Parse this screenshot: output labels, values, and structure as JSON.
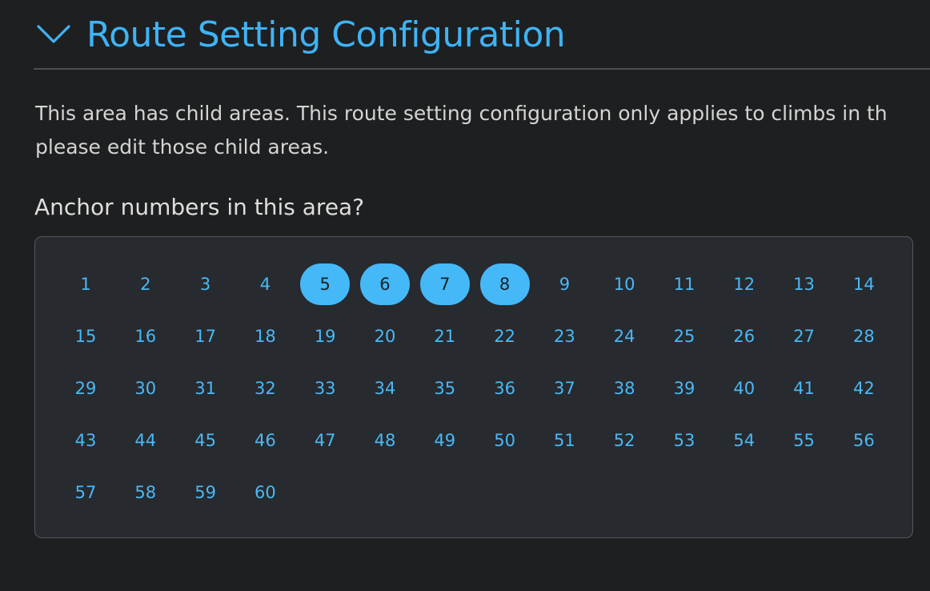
{
  "section": {
    "title": "Route Setting Configuration",
    "toggle_icon": "chevron-down-icon",
    "accent_color": "#3fb3f5"
  },
  "description": {
    "line1": "This area has child areas. This route setting configuration only applies to climbs in th",
    "line2": "please edit those child areas."
  },
  "anchor_question": "Anchor numbers in this area?",
  "anchors": {
    "selected_color": "#45b8f8",
    "items": [
      {
        "label": "1",
        "selected": false
      },
      {
        "label": "2",
        "selected": false
      },
      {
        "label": "3",
        "selected": false
      },
      {
        "label": "4",
        "selected": false
      },
      {
        "label": "5",
        "selected": true
      },
      {
        "label": "6",
        "selected": true
      },
      {
        "label": "7",
        "selected": true
      },
      {
        "label": "8",
        "selected": true
      },
      {
        "label": "9",
        "selected": false
      },
      {
        "label": "10",
        "selected": false
      },
      {
        "label": "11",
        "selected": false
      },
      {
        "label": "12",
        "selected": false
      },
      {
        "label": "13",
        "selected": false
      },
      {
        "label": "14",
        "selected": false
      },
      {
        "label": "15",
        "selected": false
      },
      {
        "label": "16",
        "selected": false
      },
      {
        "label": "17",
        "selected": false
      },
      {
        "label": "18",
        "selected": false
      },
      {
        "label": "19",
        "selected": false
      },
      {
        "label": "20",
        "selected": false
      },
      {
        "label": "21",
        "selected": false
      },
      {
        "label": "22",
        "selected": false
      },
      {
        "label": "23",
        "selected": false
      },
      {
        "label": "24",
        "selected": false
      },
      {
        "label": "25",
        "selected": false
      },
      {
        "label": "26",
        "selected": false
      },
      {
        "label": "27",
        "selected": false
      },
      {
        "label": "28",
        "selected": false
      },
      {
        "label": "29",
        "selected": false
      },
      {
        "label": "30",
        "selected": false
      },
      {
        "label": "31",
        "selected": false
      },
      {
        "label": "32",
        "selected": false
      },
      {
        "label": "33",
        "selected": false
      },
      {
        "label": "34",
        "selected": false
      },
      {
        "label": "35",
        "selected": false
      },
      {
        "label": "36",
        "selected": false
      },
      {
        "label": "37",
        "selected": false
      },
      {
        "label": "38",
        "selected": false
      },
      {
        "label": "39",
        "selected": false
      },
      {
        "label": "40",
        "selected": false
      },
      {
        "label": "41",
        "selected": false
      },
      {
        "label": "42",
        "selected": false
      },
      {
        "label": "43",
        "selected": false
      },
      {
        "label": "44",
        "selected": false
      },
      {
        "label": "45",
        "selected": false
      },
      {
        "label": "46",
        "selected": false
      },
      {
        "label": "47",
        "selected": false
      },
      {
        "label": "48",
        "selected": false
      },
      {
        "label": "49",
        "selected": false
      },
      {
        "label": "50",
        "selected": false
      },
      {
        "label": "51",
        "selected": false
      },
      {
        "label": "52",
        "selected": false
      },
      {
        "label": "53",
        "selected": false
      },
      {
        "label": "54",
        "selected": false
      },
      {
        "label": "55",
        "selected": false
      },
      {
        "label": "56",
        "selected": false
      },
      {
        "label": "57",
        "selected": false
      },
      {
        "label": "58",
        "selected": false
      },
      {
        "label": "59",
        "selected": false
      },
      {
        "label": "60",
        "selected": false
      }
    ]
  }
}
